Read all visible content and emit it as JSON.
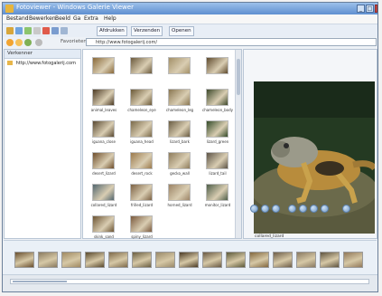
{
  "window": {
    "title": "Fotoviewer - Windows Galerie Viewer"
  },
  "menu": [
    "Bestand",
    "Bewerken",
    "Beeld",
    "Ga",
    "Extra",
    "Help"
  ],
  "toolbar": {
    "buttons": [
      "Afdrukken",
      "Verzenden",
      "Openen"
    ]
  },
  "address": {
    "label": "Favorieten",
    "value": "http://www.fotogalerij.com/"
  },
  "tree": {
    "header": "Verkenner",
    "items": [
      "http://www.fotogalerij.com"
    ]
  },
  "gallery": {
    "thumbs": [
      {
        "label": "",
        "color": "#8a6a3a"
      },
      {
        "label": "",
        "color": "#6b5a3d"
      },
      {
        "label": "",
        "color": "#a39068"
      },
      {
        "label": "",
        "color": "#5f4b2e"
      },
      {
        "label": "animal_leaves",
        "color": "#4d3b25"
      },
      {
        "label": "chameleon_eye",
        "color": "#6c5a38"
      },
      {
        "label": "chameleon_leg",
        "color": "#8a7752"
      },
      {
        "label": "chameleon_body",
        "color": "#3e4a2c"
      },
      {
        "label": "iguana_close",
        "color": "#5a4a32"
      },
      {
        "label": "iguana_head",
        "color": "#7b6a4a"
      },
      {
        "label": "lizard_bark",
        "color": "#6a5d43"
      },
      {
        "label": "lizard_green",
        "color": "#344c2a"
      },
      {
        "label": "desert_lizard",
        "color": "#6f4f2c"
      },
      {
        "label": "desert_rock",
        "color": "#9b7a4c"
      },
      {
        "label": "gecko_wall",
        "color": "#8e7c5c"
      },
      {
        "label": "lizard_tail",
        "color": "#5d5447"
      },
      {
        "label": "collared_lizard",
        "color": "#53676f"
      },
      {
        "label": "frilled_lizard",
        "color": "#7d6244"
      },
      {
        "label": "horned_lizard",
        "color": "#9c8466"
      },
      {
        "label": "monitor_lizard",
        "color": "#4f5f4a"
      },
      {
        "label": "skink_sand",
        "color": "#6d5534"
      },
      {
        "label": "spiny_lizard",
        "color": "#7a5a3e"
      }
    ]
  },
  "preview": {
    "caption": "collared_lizard",
    "controls": 8
  },
  "filmstrip": {
    "thumbs": [
      "#6a5030",
      "#8b7b60",
      "#a08a62",
      "#5a4a2e",
      "#7f6b4b",
      "#6b5f42",
      "#9a8a6a",
      "#4c3c26",
      "#6a5a44",
      "#5d5a3a",
      "#83683f",
      "#6e5e49",
      "#8a7a62",
      "#5f5440",
      "#92795a"
    ]
  },
  "colors": {
    "titlebar": "#5f8fd0",
    "accent": "#3c74c4"
  }
}
